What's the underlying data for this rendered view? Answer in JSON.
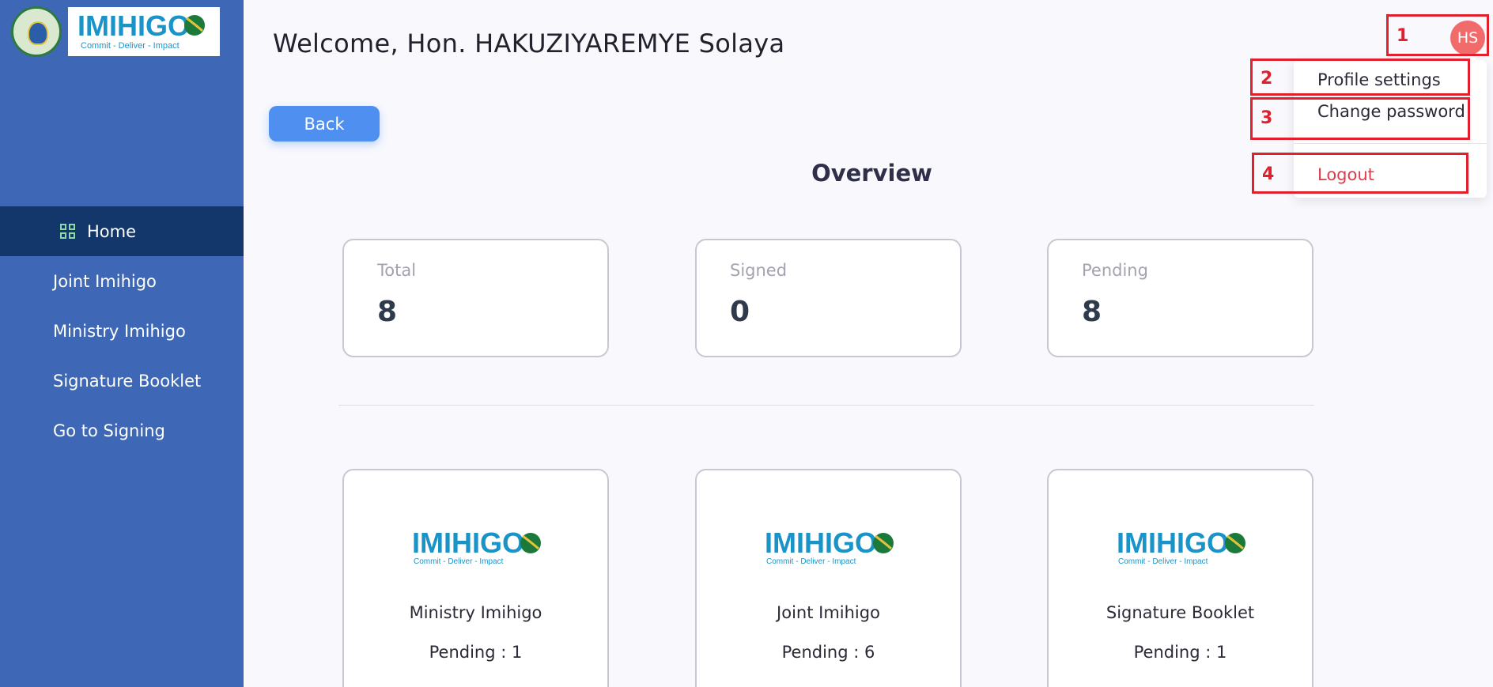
{
  "app": {
    "brand_name": "IMIHIGO",
    "brand_tagline": "Commit - Deliver - Impact"
  },
  "sidebar": {
    "items": [
      {
        "label": "Home",
        "active": true,
        "icon": "grid-icon"
      },
      {
        "label": "Joint Imihigo"
      },
      {
        "label": "Ministry Imihigo"
      },
      {
        "label": "Signature Booklet"
      },
      {
        "label": "Go to Signing"
      }
    ]
  },
  "header": {
    "welcome": "Welcome,  Hon.  HAKUZIYAREMYE Solaya",
    "avatar_initials": "HS"
  },
  "toolbar": {
    "back_label": "Back"
  },
  "overview": {
    "title": "Overview",
    "stats": [
      {
        "label": "Total",
        "value": "8"
      },
      {
        "label": "Signed",
        "value": "0"
      },
      {
        "label": "Pending",
        "value": "8"
      }
    ]
  },
  "modules": [
    {
      "title": "Ministry Imihigo",
      "pending": "Pending : 1"
    },
    {
      "title": "Joint Imihigo",
      "pending": "Pending : 6"
    },
    {
      "title": "Signature Booklet",
      "pending": "Pending : 1"
    }
  ],
  "user_menu": {
    "items": [
      {
        "label": "Profile settings"
      },
      {
        "label": "Change password"
      },
      {
        "label": "Logout"
      }
    ]
  },
  "annotations": [
    "1",
    "2",
    "3",
    "4"
  ],
  "colors": {
    "sidebar": "#3e68b5",
    "sidebar_active": "#13376a",
    "accent": "#4f8ff0",
    "avatar": "#f26b6b",
    "annotation": "#e0202c",
    "logout": "#e03b4a"
  }
}
